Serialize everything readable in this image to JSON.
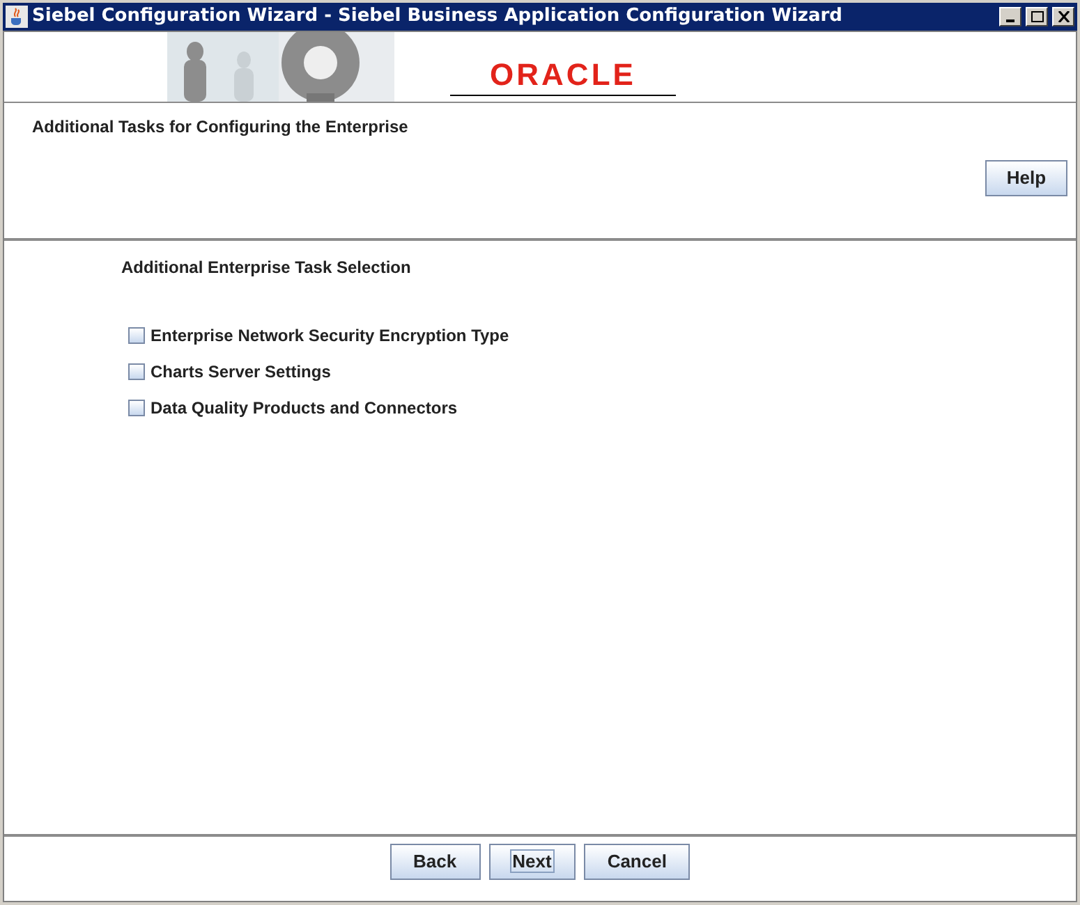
{
  "window": {
    "title": "Siebel Configuration Wizard - Siebel Business Application Configuration Wizard"
  },
  "banner": {
    "logo": "ORACLE"
  },
  "header": {
    "title": "Additional Tasks for Configuring the Enterprise",
    "help_button": "Help"
  },
  "section": {
    "title": "Additional Enterprise Task Selection"
  },
  "tasks": [
    {
      "label": "Enterprise Network Security Encryption Type",
      "checked": false
    },
    {
      "label": "Charts Server Settings",
      "checked": false
    },
    {
      "label": "Data Quality Products and Connectors",
      "checked": false
    }
  ],
  "buttons": [
    {
      "label": "Back",
      "focused": false
    },
    {
      "label": "Next",
      "focused": true
    },
    {
      "label": "Cancel",
      "focused": false
    }
  ]
}
